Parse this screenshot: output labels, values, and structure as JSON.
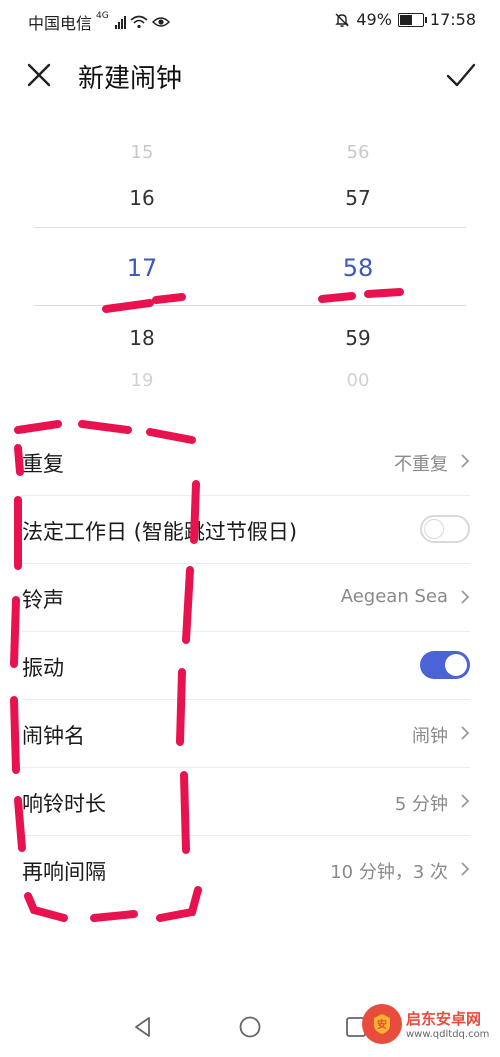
{
  "status_bar": {
    "carrier": "中国电信",
    "network": "4G",
    "battery": "49%",
    "battery_level": 0.49,
    "time": "17:58"
  },
  "header": {
    "title": "新建闹钟",
    "close_icon": "close-icon",
    "confirm_icon": "check-icon"
  },
  "time_picker": {
    "hours": [
      "15",
      "16",
      "17",
      "18",
      "19"
    ],
    "minutes": [
      "56",
      "57",
      "58",
      "59",
      "00"
    ],
    "selected_hour": "17",
    "selected_minute": "58",
    "accent_color": "#3d5ab8"
  },
  "settings": [
    {
      "label": "重复",
      "value": "不重复",
      "control": "chevron"
    },
    {
      "label": "法定工作日 (智能跳过节假日)",
      "value": "",
      "control": "toggle",
      "on": false
    },
    {
      "label": "铃声",
      "value": "Aegean Sea",
      "control": "chevron"
    },
    {
      "label": "振动",
      "value": "",
      "control": "toggle",
      "on": true
    },
    {
      "label": "闹钟名",
      "value": "闹钟",
      "control": "chevron"
    },
    {
      "label": "响铃时长",
      "value": "5 分钟",
      "control": "chevron"
    },
    {
      "label": "再响间隔",
      "value": "10 分钟，3 次",
      "control": "chevron"
    }
  ],
  "toggle_on_color": "#4a64d8",
  "annotation_color": "#e8124f",
  "nav": {
    "back_icon": "triangle-back-icon",
    "home_icon": "circle-home-icon",
    "recent_icon": "square-recent-icon"
  },
  "watermark": {
    "name": "启东安卓网",
    "url": "www.qdltdq.com"
  }
}
